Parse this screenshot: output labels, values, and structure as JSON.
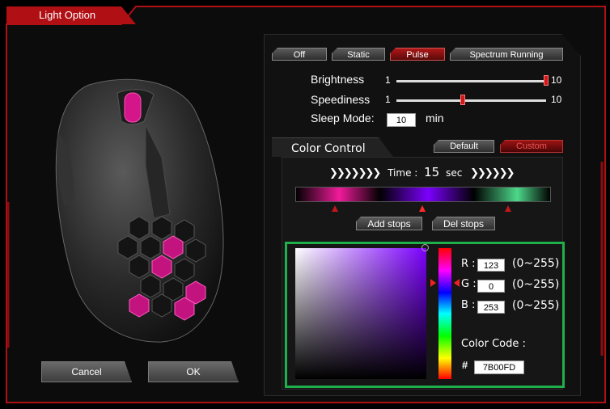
{
  "window": {
    "title": "Light Option"
  },
  "modes": {
    "off": "Off",
    "static": "Static",
    "pulse": "Pulse",
    "spectrum": "Spectrum Running",
    "selected": "Pulse"
  },
  "brightness": {
    "label": "Brightness",
    "min": "1",
    "max": "10",
    "value": 10
  },
  "speediness": {
    "label": "Speediness",
    "min": "1",
    "max": "10",
    "value": 5
  },
  "sleep": {
    "label": "Sleep Mode:",
    "value": "10",
    "unit": "min"
  },
  "color_control": {
    "tab_label": "Color Control",
    "default_label": "Default",
    "custom_label": "Custom",
    "time_label": "Time :",
    "time_value": "15",
    "time_unit": "sec",
    "add_stops": "Add stops",
    "del_stops": "Del stops",
    "stops": [
      "#f21b9b",
      "#7b00fd",
      "#4dd88a"
    ],
    "selected_stop": 1
  },
  "picker": {
    "r_label": "R :",
    "r_value": "123",
    "r_range": "(0~255)",
    "g_label": "G :",
    "g_value": "0",
    "g_range": "(0~255)",
    "b_label": "B :",
    "b_value": "253",
    "b_range": "(0~255)",
    "code_label": "Color Code :",
    "hash": "#",
    "code_value": "7B00FD"
  },
  "footer": {
    "cancel": "Cancel",
    "ok": "OK"
  },
  "colors": {
    "accent": "#c8141a",
    "green_frame": "#1fb04b",
    "selected_color": "#7b00fd"
  }
}
